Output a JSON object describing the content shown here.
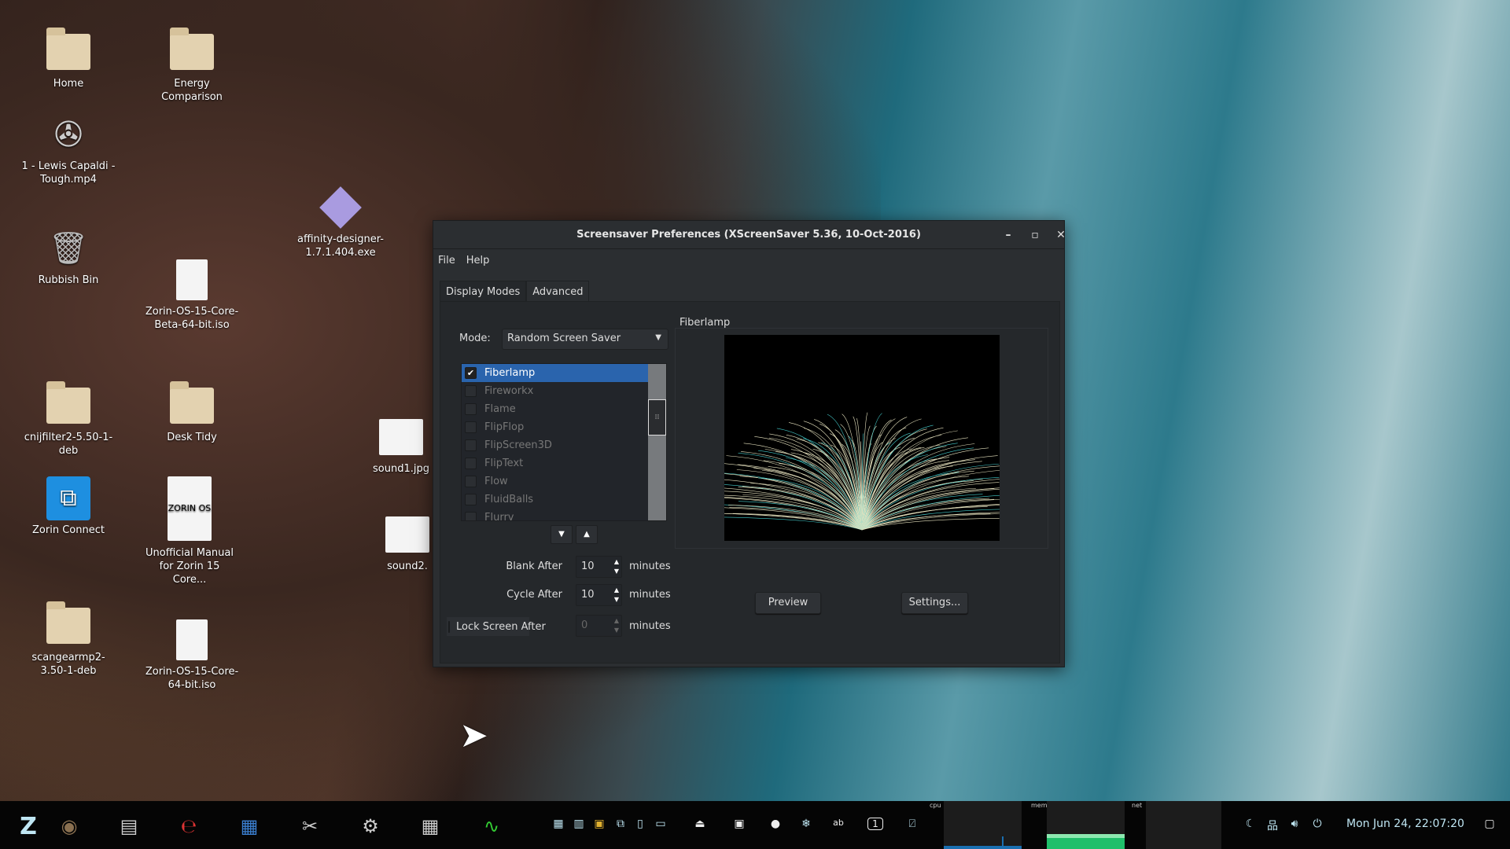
{
  "desktop": {
    "icons": [
      {
        "label": "Home",
        "type": "home-folder"
      },
      {
        "label": "Energy Comparison",
        "type": "folder"
      },
      {
        "label": "1 - Lewis Capaldi - Tough.mp4",
        "type": "video"
      },
      {
        "label": "Rubbish Bin",
        "type": "trash"
      },
      {
        "label": "affinity-designer-1.7.1.404.exe",
        "type": "exe"
      },
      {
        "label": "Zorin-OS-15-Core-Beta-64-bit.iso",
        "type": "document"
      },
      {
        "label": "cnijfilter2-5.50-1-deb",
        "type": "folder"
      },
      {
        "label": "Desk Tidy",
        "type": "folder"
      },
      {
        "label": "Zorin Connect",
        "type": "app"
      },
      {
        "label": "Unofficial Manual for Zorin 15 Core...",
        "type": "pdf"
      },
      {
        "label": "scangearmp2-3.50-1-deb",
        "type": "folder"
      },
      {
        "label": "Zorin-OS-15-Core-64-bit.iso",
        "type": "document"
      },
      {
        "label": "sound1.jpg",
        "type": "image"
      },
      {
        "label": "sound2.",
        "type": "image"
      }
    ]
  },
  "window": {
    "title": "Screensaver Preferences  (XScreenSaver 5.36, 10-Oct-2016)",
    "controls": {
      "minimize": "–",
      "maximize": "▫",
      "close": "✕"
    },
    "menu": [
      "File",
      "Help"
    ],
    "tabs": [
      {
        "label": "Display Modes",
        "active": true
      },
      {
        "label": "Advanced",
        "active": false
      }
    ],
    "mode_label": "Mode:",
    "mode_value": "Random Screen Saver",
    "savers": [
      {
        "name": "Fiberlamp",
        "checked": true,
        "selected": true
      },
      {
        "name": "Fireworkx",
        "checked": false
      },
      {
        "name": "Flame",
        "checked": false
      },
      {
        "name": "FlipFlop",
        "checked": false
      },
      {
        "name": "FlipScreen3D",
        "checked": false
      },
      {
        "name": "FlipText",
        "checked": false
      },
      {
        "name": "Flow",
        "checked": false
      },
      {
        "name": "FluidBalls",
        "checked": false
      },
      {
        "name": "Flurry",
        "checked": false
      }
    ],
    "preview_title": "Fiberlamp",
    "blank_after": {
      "label": "Blank After",
      "value": "10",
      "unit": "minutes"
    },
    "cycle_after": {
      "label": "Cycle After",
      "value": "10",
      "unit": "minutes"
    },
    "lock_after": {
      "label": "Lock Screen After",
      "value": "0",
      "unit": "minutes",
      "checked": false
    },
    "preview_button": "Preview",
    "settings_button": "Settings..."
  },
  "taskbar": {
    "apps": [
      "zorin-menu",
      "screenshot",
      "file-manager",
      "document-viewer",
      "writer",
      "system-tools",
      "settings-mixer",
      "calculator",
      "system-monitor"
    ],
    "graphs": {
      "cpu": "cpu",
      "mem": "mem",
      "net": "net"
    },
    "workspace": "1",
    "clock": "Mon Jun 24, 22:07:20",
    "colors": {
      "selection": "#2a64ad",
      "mem_graph": "#1fbf6a",
      "cpu_graph": "#1a6fb0"
    }
  }
}
